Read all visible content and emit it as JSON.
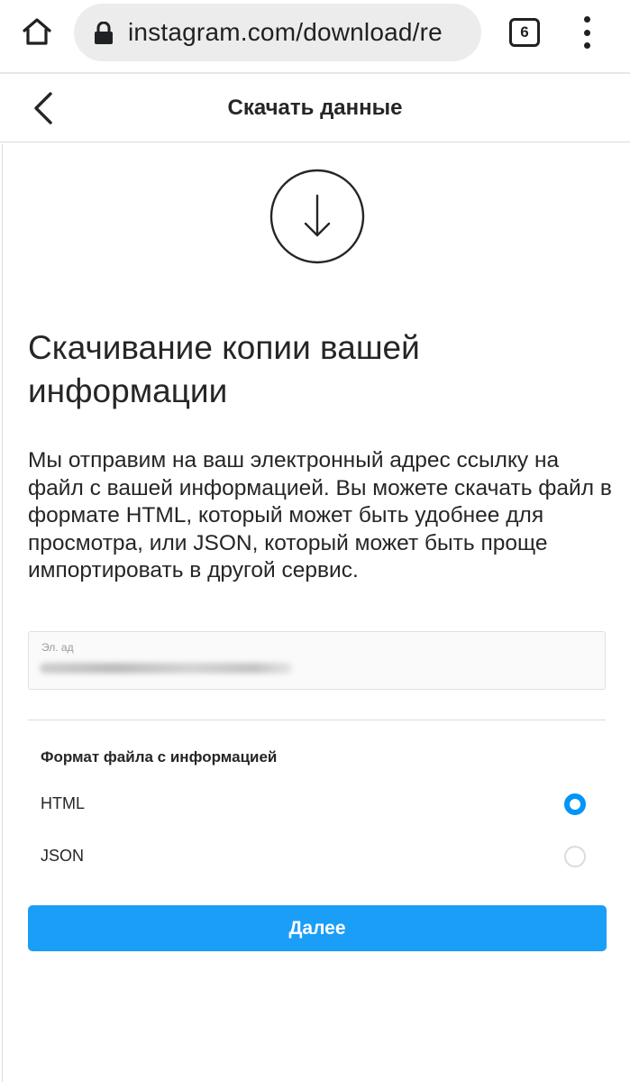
{
  "browser": {
    "url": "instagram.com/download/re",
    "tab_count": "6"
  },
  "header": {
    "title": "Скачать данные"
  },
  "main": {
    "heading": "Скачивание копии вашей информации",
    "description": "Мы отправим на ваш электронный адрес ссылку на файл с вашей информацией. Вы можете скачать файл в формате HTML, который может быть удобнее для просмотра, или JSON, который может быть проще импортировать в другой сервис.",
    "email_field": {
      "label": "Эл. ад"
    },
    "format_section": {
      "title": "Формат файла с информацией",
      "options": [
        {
          "label": "HTML",
          "selected": true
        },
        {
          "label": "JSON",
          "selected": false
        }
      ]
    },
    "next_button": "Далее"
  },
  "colors": {
    "accent": "#0095f6",
    "button": "#1a9ef7"
  }
}
